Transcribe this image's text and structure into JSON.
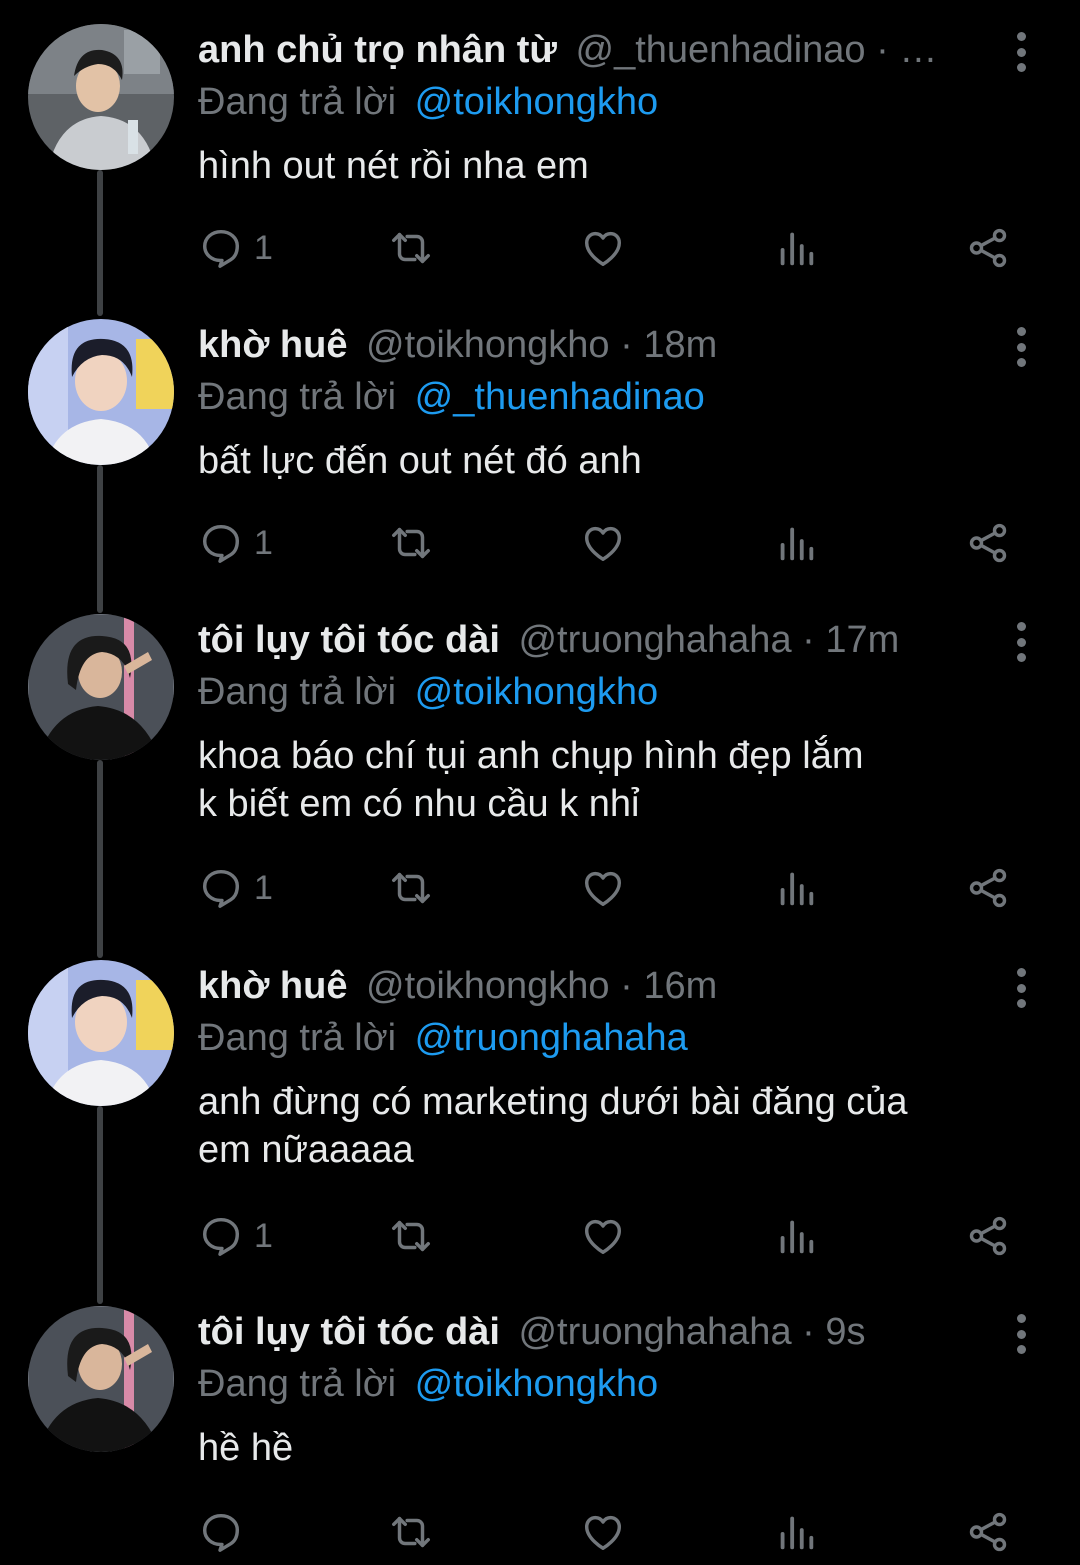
{
  "ui_colors": {
    "background": "#000000",
    "text": "#e7e9ea",
    "muted": "#71767b",
    "mention": "#1d9bf0",
    "thread_line": "#3e4144"
  },
  "icons": [
    "reply-icon",
    "retweet-icon",
    "like-icon",
    "views-icon",
    "share-icon",
    "more-icon"
  ],
  "reply_prefix": "Đang trả lời",
  "tweets": [
    {
      "display_name": "anh chủ trọ nhân từ",
      "handle": "@_thuenhadinao",
      "meta": " · …",
      "reply_to": "@toikhongkho",
      "text": "hình out nét rồi nha em",
      "reply_count": "1"
    },
    {
      "display_name": "khờ huê",
      "handle": "@toikhongkho",
      "meta": " · 18m",
      "reply_to": "@_thuenhadinao",
      "text": "bất lực đến out nét đó anh",
      "reply_count": "1"
    },
    {
      "display_name": "tôi lụy tôi tóc dài",
      "handle": "@truonghahaha",
      "meta": " · 17m",
      "reply_to": "@toikhongkho",
      "text": "khoa báo chí tụi anh chụp hình đẹp lắm\nk biết em có nhu cầu k nhỉ",
      "reply_count": "1"
    },
    {
      "display_name": "khờ huê",
      "handle": "@toikhongkho",
      "meta": " · 16m",
      "reply_to": "@truonghahaha",
      "text": "anh đừng có marketing dưới bài đăng của\nem nữaaaaa",
      "reply_count": "1"
    },
    {
      "display_name": "tôi lụy tôi tóc dài",
      "handle": "@truonghahaha",
      "meta": " · 9s",
      "reply_to": "@toikhongkho",
      "text": "hề hề",
      "reply_count": ""
    }
  ]
}
